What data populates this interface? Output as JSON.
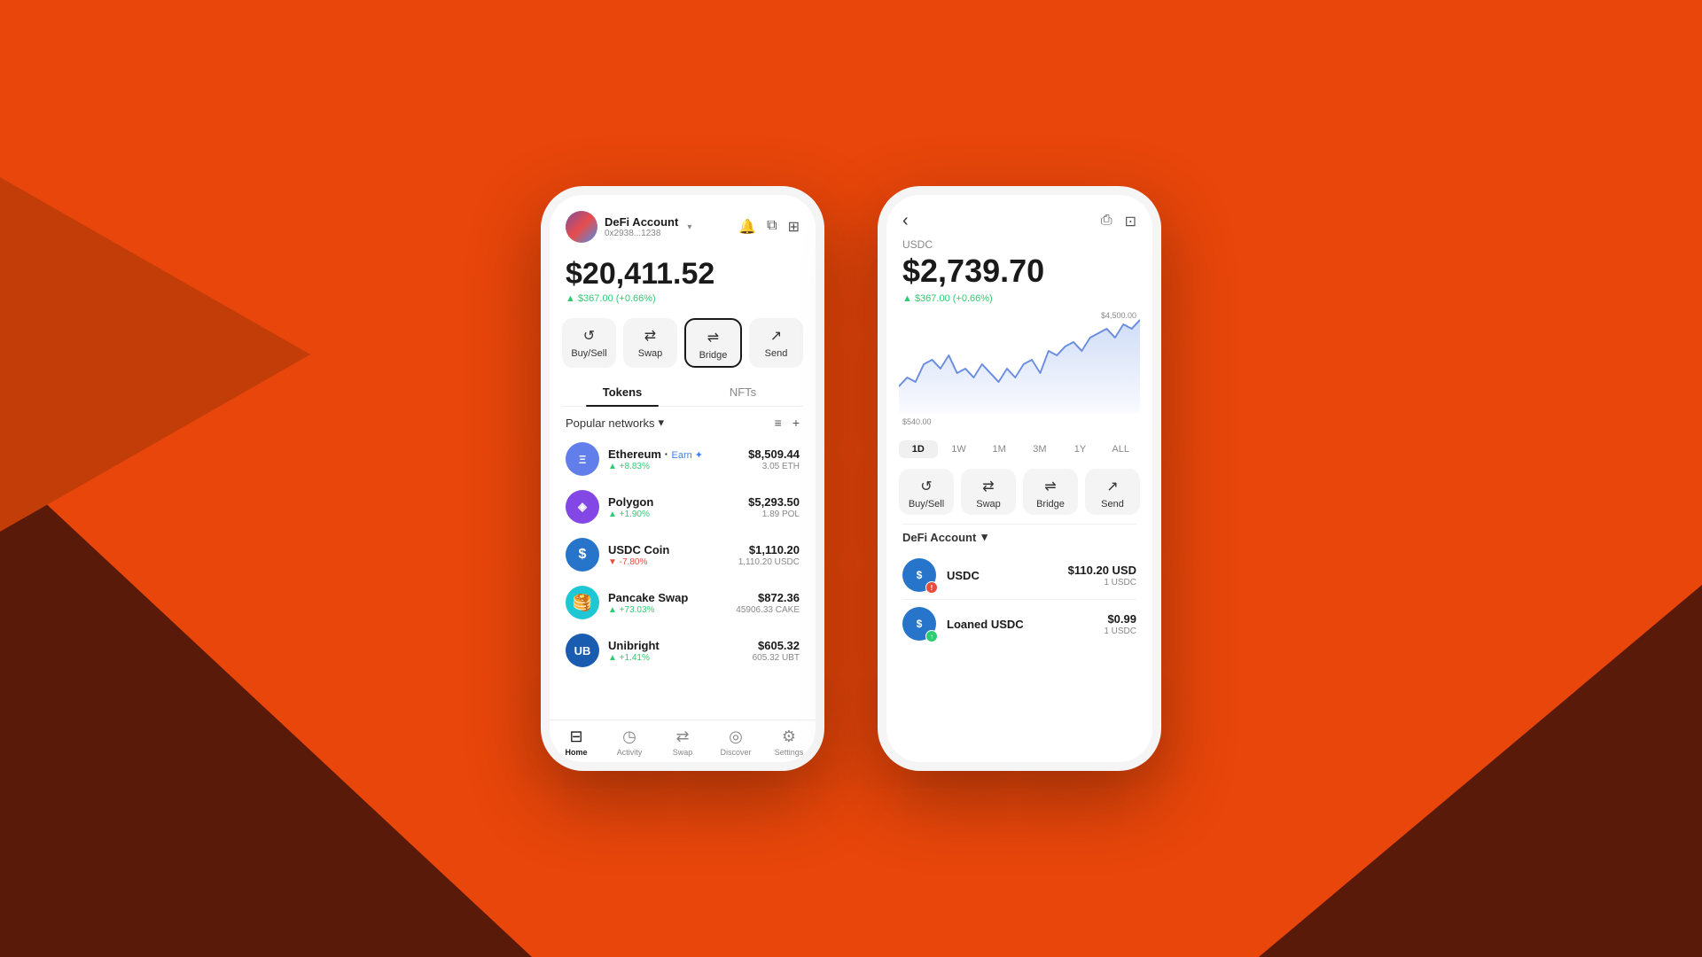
{
  "background": {
    "color": "#E8460A"
  },
  "phone1": {
    "header": {
      "account_name": "DeFi Account",
      "account_address": "0x2938...1238",
      "chevron": "▾"
    },
    "balance": {
      "amount": "$20,411.52",
      "change": "▲ $367.00 (+0.66%)"
    },
    "actions": [
      {
        "id": "buy-sell",
        "icon": "↺",
        "label": "Buy/Sell"
      },
      {
        "id": "swap",
        "icon": "⇄",
        "label": "Swap"
      },
      {
        "id": "bridge",
        "icon": "⟁",
        "label": "Bridge"
      },
      {
        "id": "send",
        "icon": "↗",
        "label": "Send"
      }
    ],
    "tabs": [
      {
        "id": "tokens",
        "label": "Tokens",
        "active": true
      },
      {
        "id": "nfts",
        "label": "NFTs",
        "active": false
      }
    ],
    "popular_networks_label": "Popular networks",
    "tokens": [
      {
        "id": "eth",
        "name": "Ethereum",
        "earn_label": "Earn",
        "change": "+8.83%",
        "change_dir": "up",
        "value_usd": "$8,509.44",
        "value_token": "3.05 ETH",
        "logo_text": "Ξ",
        "logo_class": "token-logo-eth"
      },
      {
        "id": "pol",
        "name": "Polygon",
        "change": "+1.90%",
        "change_dir": "up",
        "value_usd": "$5,293.50",
        "value_token": "1.89 POL",
        "logo_text": "◈",
        "logo_class": "token-logo-pol"
      },
      {
        "id": "usdc",
        "name": "USDC Coin",
        "change": "-7.80%",
        "change_dir": "down",
        "value_usd": "$1,110.20",
        "value_token": "1,110.20 USDC",
        "logo_text": "$",
        "logo_class": "token-logo-usdc"
      },
      {
        "id": "cake",
        "name": "Pancake Swap",
        "change": "+73.03%",
        "change_dir": "up",
        "value_usd": "$872.36",
        "value_token": "45906.33 CAKE",
        "logo_text": "🥞",
        "logo_class": "token-logo-cake"
      },
      {
        "id": "ub",
        "name": "Unibright",
        "change": "+1.41%",
        "change_dir": "up",
        "value_usd": "$605.32",
        "value_token": "605.32 UBT",
        "logo_text": "UB",
        "logo_class": "token-logo-ub"
      }
    ],
    "bottom_nav": [
      {
        "id": "home",
        "icon": "⊟",
        "label": "Home",
        "active": true
      },
      {
        "id": "activity",
        "icon": "◷",
        "label": "Activity",
        "active": false
      },
      {
        "id": "swap",
        "icon": "⇄",
        "label": "Swap",
        "active": false
      },
      {
        "id": "discover",
        "icon": "◎",
        "label": "Discover",
        "active": false
      },
      {
        "id": "settings",
        "icon": "⚙",
        "label": "Settings",
        "active": false
      }
    ]
  },
  "phone2": {
    "token_label": "USDC",
    "balance": "$2,739.70",
    "change": "▲ $367.00 (+0.66%)",
    "chart": {
      "high_label": "$4,500.00",
      "low_label": "$540.00"
    },
    "time_ranges": [
      {
        "id": "1d",
        "label": "1D",
        "active": true
      },
      {
        "id": "1w",
        "label": "1W",
        "active": false
      },
      {
        "id": "1m",
        "label": "1M",
        "active": false
      },
      {
        "id": "3m",
        "label": "3M",
        "active": false
      },
      {
        "id": "1y",
        "label": "1Y",
        "active": false
      },
      {
        "id": "all",
        "label": "ALL",
        "active": false
      }
    ],
    "actions": [
      {
        "id": "buy-sell",
        "icon": "↺",
        "label": "Buy/Sell"
      },
      {
        "id": "swap",
        "icon": "⇄",
        "label": "Swap"
      },
      {
        "id": "bridge",
        "icon": "⟁",
        "label": "Bridge"
      },
      {
        "id": "send",
        "icon": "↗",
        "label": "Send"
      }
    ],
    "defi_account_label": "DeFi Account",
    "account_tokens": [
      {
        "id": "usdc",
        "name": "USDC",
        "sub": "",
        "value_usd": "$110.20 USD",
        "value_token": "1 USDC",
        "logo_text": "$",
        "has_badge": true,
        "badge": "!"
      },
      {
        "id": "loaned-usdc",
        "name": "Loaned USDC",
        "sub": "",
        "value_usd": "$0.99",
        "value_token": "1 USDC",
        "logo_text": "$",
        "has_badge": true,
        "badge": "↑"
      }
    ]
  }
}
